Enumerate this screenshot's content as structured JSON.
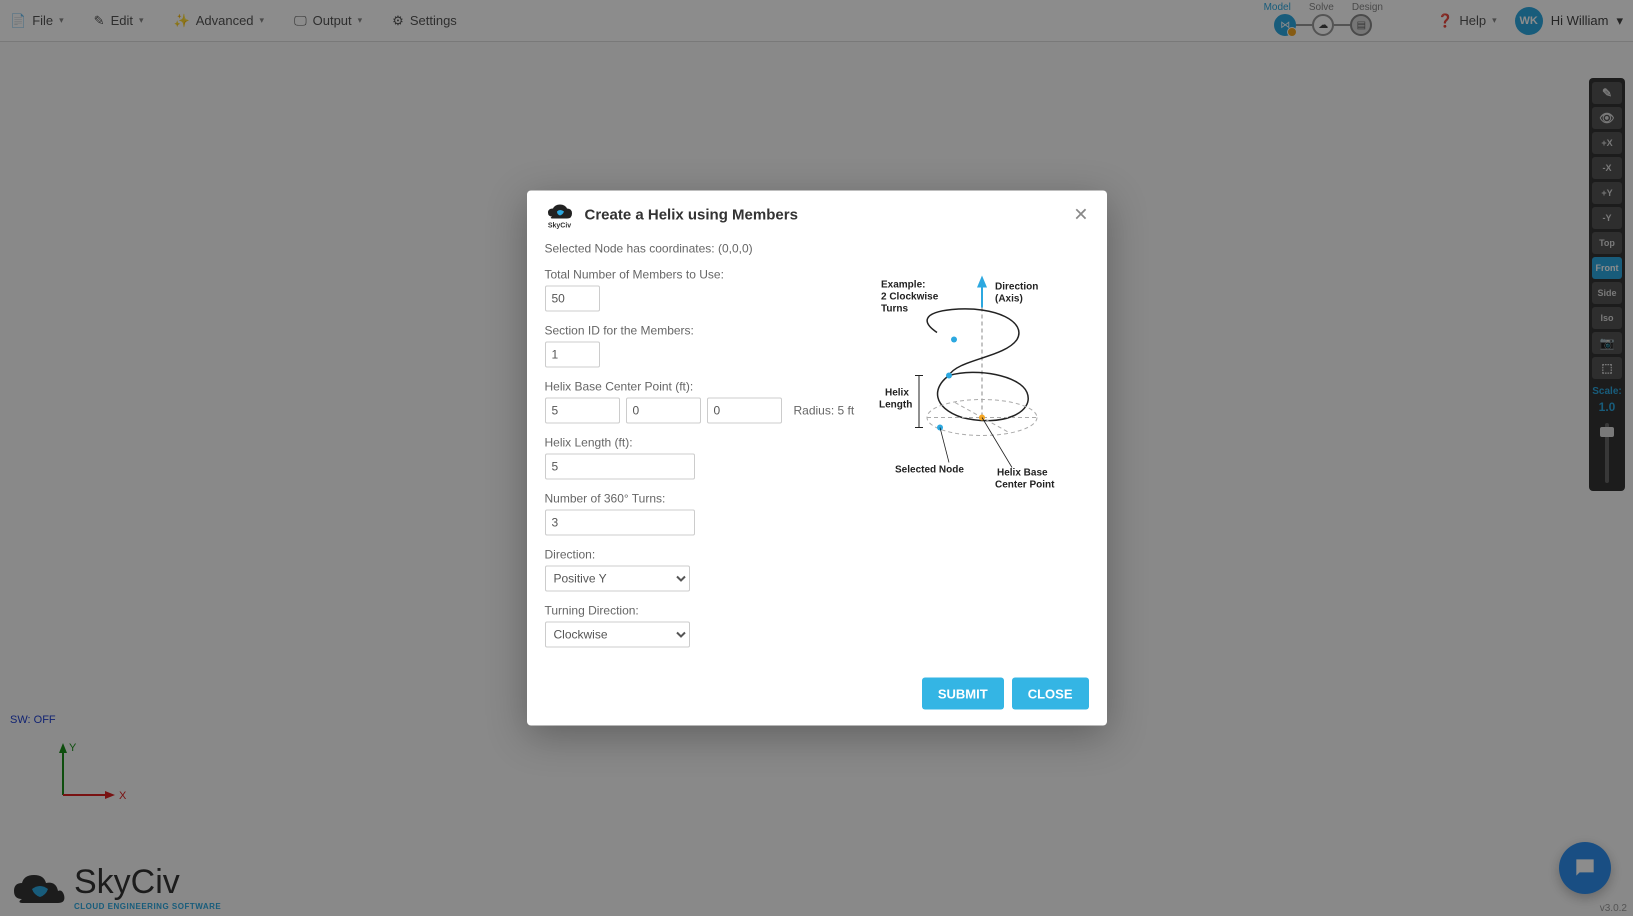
{
  "menu": {
    "file": "File",
    "edit": "Edit",
    "advanced": "Advanced",
    "output": "Output",
    "settings": "Settings",
    "help": "Help",
    "user_greeting": "Hi William",
    "user_initials": "WK"
  },
  "modes": {
    "model": "Model",
    "solve": "Solve",
    "design": "Design"
  },
  "right_toolbar": {
    "plus_x": "+X",
    "minus_x": "-X",
    "plus_y": "+Y",
    "minus_y": "-Y",
    "top": "Top",
    "front": "Front",
    "side": "Side",
    "iso": "Iso",
    "scale_label": "Scale:",
    "scale_value": "1.0"
  },
  "canvas": {
    "sw_off": "SW: OFF",
    "axis_x": "X",
    "axis_y": "Y",
    "logo_main": "SkyCiv",
    "logo_sub": "CLOUD ENGINEERING SOFTWARE",
    "version": "v3.0.2"
  },
  "modal": {
    "title": "Create a Helix using Members",
    "logo_sub": "SkyCiv",
    "intro": "Selected Node has coordinates: (0,0,0)",
    "lbl_total": "Total Number of Members to Use:",
    "val_total": "50",
    "lbl_section": "Section ID for the Members:",
    "val_section": "1",
    "lbl_base": "Helix Base Center Point (ft):",
    "val_bx": "5",
    "val_by": "0",
    "val_bz": "0",
    "radius": "Radius: 5 ft",
    "lbl_length": "Helix Length (ft):",
    "val_length": "5",
    "lbl_turns": "Number of 360° Turns:",
    "val_turns": "3",
    "lbl_direction": "Direction:",
    "val_direction": "Positive Y",
    "lbl_turning": "Turning Direction:",
    "val_turning": "Clockwise",
    "btn_submit": "SUBMIT",
    "btn_close": "CLOSE",
    "diag": {
      "example1": "Example:",
      "example2": "2 Clockwise",
      "example3": "Turns",
      "dir1": "Direction",
      "dir2": "(Axis)",
      "helix1": "Helix",
      "helix2": "Length",
      "selnode": "Selected Node",
      "base1": "Helix Base",
      "base2": "Center Point"
    }
  }
}
